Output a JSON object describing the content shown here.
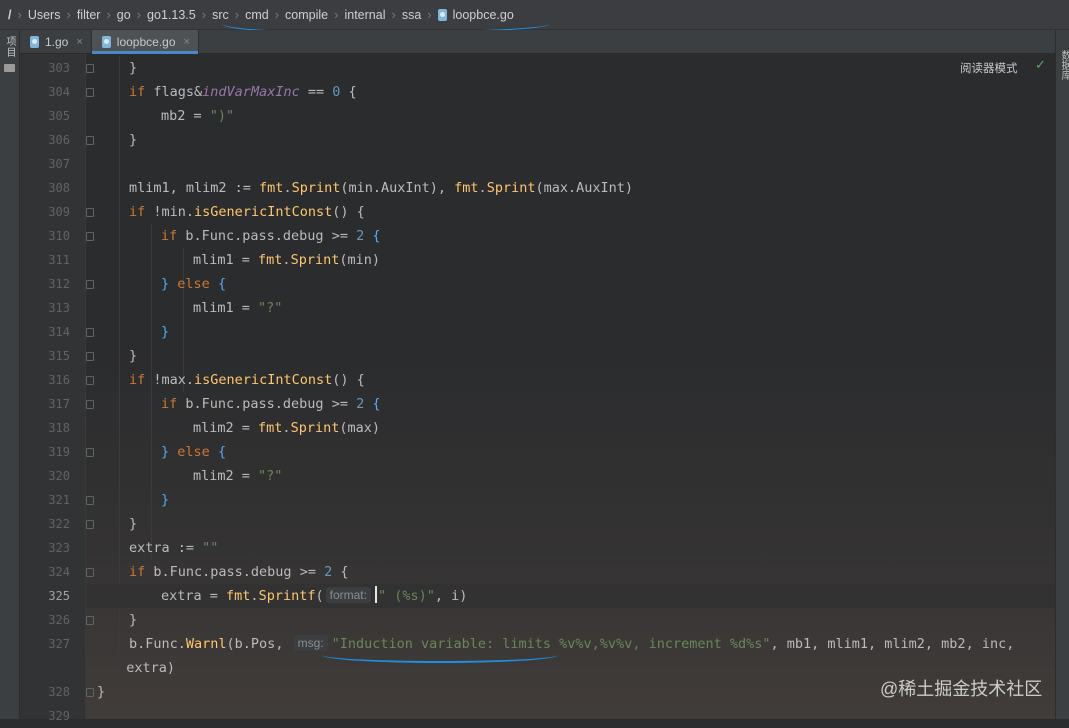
{
  "breadcrumb": {
    "items": [
      "/",
      "Users",
      "filter",
      "go",
      "go1.13.5",
      "src",
      "cmd",
      "compile",
      "internal",
      "ssa",
      "loopbce.go"
    ]
  },
  "tabs": [
    {
      "label": "1.go",
      "active": false
    },
    {
      "label": "loopbce.go",
      "active": true
    }
  ],
  "left_sidebar": {
    "project_label": "项目"
  },
  "right_sidebar": {
    "label": "数据库"
  },
  "editor": {
    "reader_mode_label": "阅读器模式",
    "current_line": 325,
    "hint_format": "format:",
    "hint_msg": "msg:"
  },
  "lines": [
    {
      "n": "303",
      "indent": 1,
      "html": "}",
      "fold": true
    },
    {
      "n": "304",
      "indent": 1,
      "html": "<span class=\"kw\">if</span> flags&amp;<span class=\"it\">indVarMaxInc</span> == <span class=\"num\">0</span> {",
      "fold": true
    },
    {
      "n": "305",
      "indent": 2,
      "html": "mb2 = <span class=\"str\">\")\"</span>"
    },
    {
      "n": "306",
      "indent": 1,
      "html": "}",
      "fold": true
    },
    {
      "n": "307",
      "indent": 0,
      "html": ""
    },
    {
      "n": "308",
      "indent": 1,
      "html": "mlim1, mlim2 := <span class=\"fn\">fmt</span>.<span class=\"fn\">Sprint</span>(min.AuxInt), <span class=\"fn\">fmt</span>.<span class=\"fn\">Sprint</span>(max.AuxInt)"
    },
    {
      "n": "309",
      "indent": 1,
      "html": "<span class=\"kw\">if</span> !min.<span class=\"fn\">isGenericIntConst</span>() {",
      "fold": true
    },
    {
      "n": "310",
      "indent": 2,
      "html": "<span class=\"kw\">if</span> b.Func.pass.debug &gt;= <span class=\"num\">2</span> <span class=\"br-blue\">{</span>",
      "fold": true
    },
    {
      "n": "311",
      "indent": 3,
      "html": "mlim1 = <span class=\"fn\">fmt</span>.<span class=\"fn\">Sprint</span>(min)"
    },
    {
      "n": "312",
      "indent": 2,
      "html": "<span class=\"br-blue\">}</span> <span class=\"kw\">else</span> <span class=\"br-blue\">{</span>",
      "fold": true
    },
    {
      "n": "313",
      "indent": 3,
      "html": "mlim1 = <span class=\"str\">\"?\"</span>"
    },
    {
      "n": "314",
      "indent": 2,
      "html": "<span class=\"br-blue\">}</span>",
      "fold": true
    },
    {
      "n": "315",
      "indent": 1,
      "html": "}",
      "fold": true
    },
    {
      "n": "316",
      "indent": 1,
      "html": "<span class=\"kw\">if</span> !max.<span class=\"fn\">isGenericIntConst</span>() {",
      "fold": true
    },
    {
      "n": "317",
      "indent": 2,
      "html": "<span class=\"kw\">if</span> b.Func.pass.debug &gt;= <span class=\"num\">2</span> <span class=\"br-blue\">{</span>",
      "fold": true
    },
    {
      "n": "318",
      "indent": 3,
      "html": "mlim2 = <span class=\"fn\">fmt</span>.<span class=\"fn\">Sprint</span>(max)"
    },
    {
      "n": "319",
      "indent": 2,
      "html": "<span class=\"br-blue\">}</span> <span class=\"kw\">else</span> <span class=\"br-blue\">{</span>",
      "fold": true
    },
    {
      "n": "320",
      "indent": 3,
      "html": "mlim2 = <span class=\"str\">\"?\"</span>"
    },
    {
      "n": "321",
      "indent": 2,
      "html": "<span class=\"br-blue\">}</span>",
      "fold": true
    },
    {
      "n": "322",
      "indent": 1,
      "html": "}",
      "fold": true
    },
    {
      "n": "323",
      "indent": 1,
      "html": "extra := <span class=\"str\">\"\"</span>"
    },
    {
      "n": "324",
      "indent": 1,
      "html": "<span class=\"kw\">if</span> b.Func.pass.debug &gt;= <span class=\"num\">2</span> {",
      "fold": true
    },
    {
      "n": "325",
      "indent": 2,
      "html": "extra = <span class=\"fn\">fmt</span>.<span class=\"fn\">Sprintf</span>(<span class=\"hint\" data-name=\"format-param-hint\">format:</span><span class=\"caret\" data-name=\"text-caret\"></span><span class=\"str\">\" (%s)\"</span>, i)"
    },
    {
      "n": "326",
      "indent": 1,
      "html": "}",
      "fold": true
    },
    {
      "n": "327",
      "indent": 1,
      "html": "b.Func.<span class=\"fn\">Warnl</span>(b.Pos, <span class=\"hint\" data-name=\"msg-param-hint\">msg:</span><span class=\"str\">\"Induction variable: limits %v%v,%v%v, increment %d%s\"</span>, mb1, mlim1, mlim2, mb2, inc,"
    },
    {
      "n": "",
      "indent": 0,
      "html": "  extra)"
    },
    {
      "n": "328",
      "indent": 0,
      "html": "}",
      "fold": true
    },
    {
      "n": "329",
      "indent": 0,
      "html": ""
    }
  ],
  "watermark": "@稀土掘金技术社区"
}
